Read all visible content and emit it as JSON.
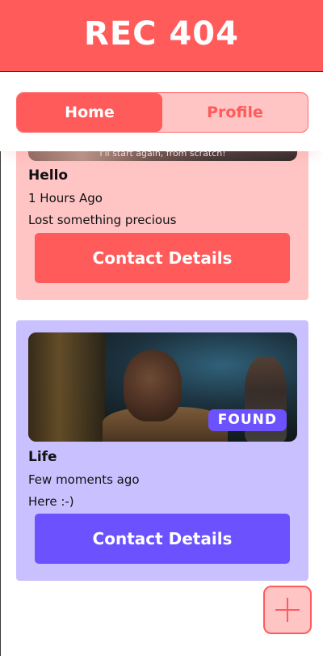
{
  "app": {
    "title": "REC 404"
  },
  "tabs": [
    {
      "label": "Home",
      "active": true
    },
    {
      "label": "Profile",
      "active": false
    }
  ],
  "posts": [
    {
      "title": "Hello",
      "time": "1 Hours Ago",
      "description": "Lost something precious",
      "image_caption": "I'll start again, from scratch!",
      "button_label": "Contact Details",
      "card_color": "#ffc4c4",
      "button_color": "#ff5b5b"
    },
    {
      "title": "Life",
      "time": "Few moments ago",
      "description": "Here :-)",
      "badge": "FOUND",
      "button_label": "Contact Details",
      "card_color": "#c9c1ff",
      "button_color": "#6c52ff"
    }
  ],
  "fab": {
    "icon": "plus-icon"
  },
  "colors": {
    "primary": "#ff5b5b",
    "primary_light": "#ffc4c4",
    "accent": "#6c52ff",
    "accent_light": "#c9c1ff"
  }
}
